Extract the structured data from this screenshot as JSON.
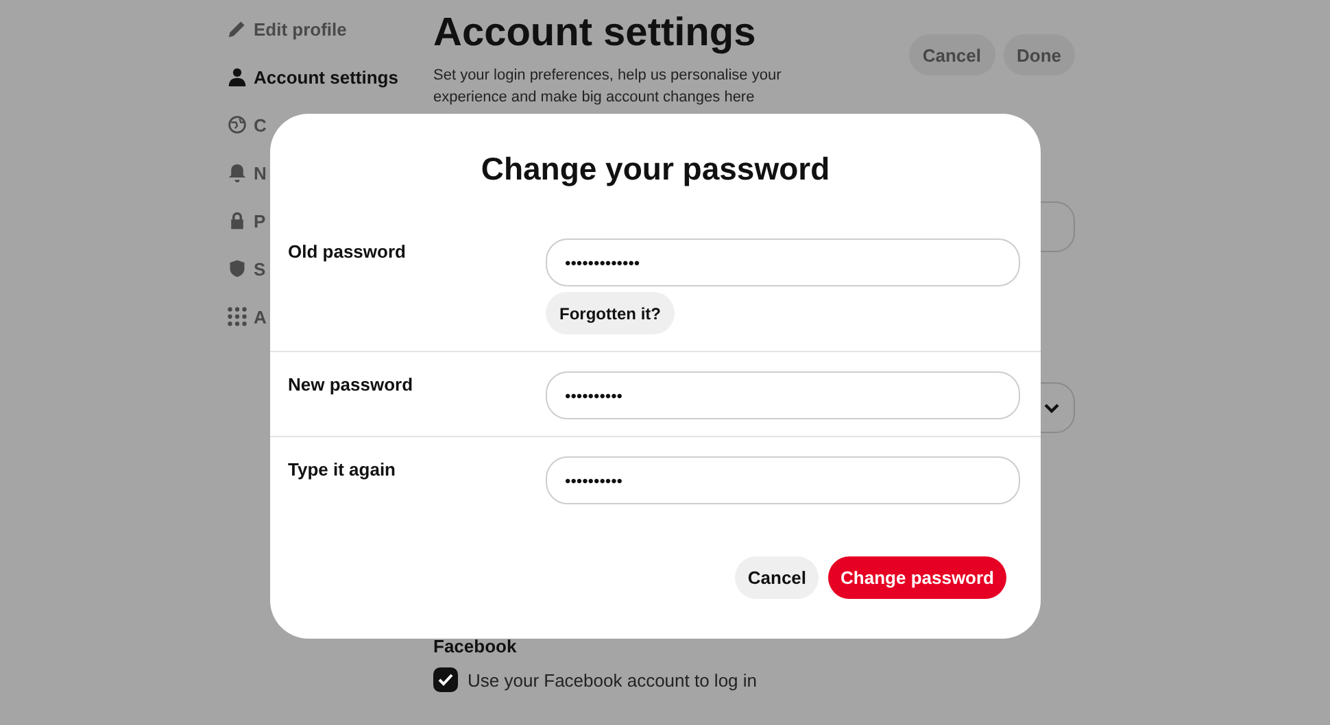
{
  "sidebar": {
    "items": [
      {
        "label": "Edit profile",
        "selected": false
      },
      {
        "label": "Account settings",
        "selected": true
      },
      {
        "label": "C",
        "selected": false
      },
      {
        "label": "N",
        "selected": false
      },
      {
        "label": "P",
        "selected": false
      },
      {
        "label": "S",
        "selected": false
      },
      {
        "label": "A",
        "selected": false
      }
    ]
  },
  "header": {
    "title": "Account settings",
    "description": "Set your login preferences, help us personalise your experience and make big account changes here",
    "buttons": [
      "Cancel",
      "Done"
    ]
  },
  "facebook": {
    "heading": "Facebook",
    "checkbox": {
      "label": "Use your Facebook account to log in",
      "checked": true
    }
  },
  "dialog": {
    "title": "Change your password",
    "fields": [
      {
        "label": "Old password",
        "value": "•••••••••••••",
        "link": "Forgotten it?"
      },
      {
        "label": "New password",
        "value": "••••••••••"
      },
      {
        "label": "Type it again",
        "value": "••••••••••"
      }
    ],
    "buttons": [
      {
        "label": "Cancel",
        "kind": "secondary"
      },
      {
        "label": "Change password",
        "kind": "primary"
      }
    ]
  }
}
